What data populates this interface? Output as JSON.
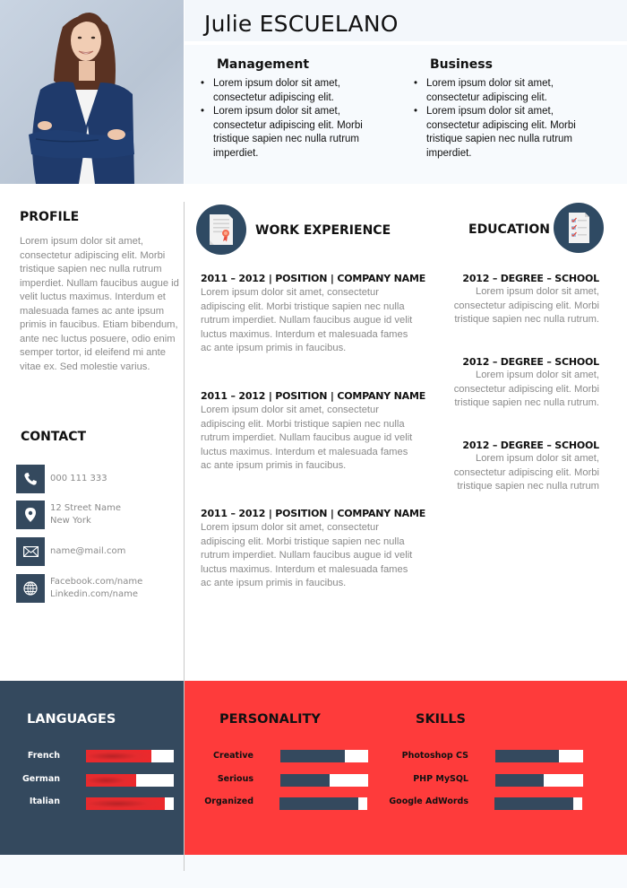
{
  "header": {
    "name": "Julie ESCUELANO",
    "columns": [
      {
        "title": "Management",
        "bullets": [
          "Lorem ipsum dolor sit amet, consectetur adipiscing elit.",
          "Lorem ipsum dolor sit amet, consectetur adipiscing elit. Morbi tristique sapien nec nulla rutrum imperdiet."
        ]
      },
      {
        "title": "Business",
        "bullets": [
          "Lorem ipsum dolor sit amet, consectetur adipiscing elit.",
          "Lorem ipsum dolor sit amet, consectetur adipiscing elit. Morbi tristique sapien nec nulla rutrum imperdiet."
        ]
      }
    ]
  },
  "photo": {
    "alt": "portrait-photo"
  },
  "profile": {
    "title": "PROFILE",
    "text": "Lorem ipsum dolor sit amet, consectetur adipiscing elit. Morbi tristique sapien nec nulla rutrum imperdiet. Nullam faucibus augue id velit luctus maximus. Interdum et malesuada fames ac ante ipsum primis in faucibus. Etiam bibendum, ante nec luctus posuere, odio enim semper tortor, id eleifend mi ante vitae ex. Sed molestie varius."
  },
  "contact": {
    "title": "CONTACT",
    "items": [
      {
        "icon": "phone-icon",
        "lines": [
          "000 111 333"
        ]
      },
      {
        "icon": "location-pin-icon",
        "lines": [
          "12 Street  Name",
          "New York"
        ]
      },
      {
        "icon": "envelope-icon",
        "lines": [
          "name@mail.com"
        ]
      },
      {
        "icon": "globe-icon",
        "lines": [
          "Facebook.com/name",
          "Linkedin.com/name"
        ]
      }
    ]
  },
  "work": {
    "title": "WORK EXPERIENCE",
    "icon": "certificate-icon",
    "jobs": [
      {
        "heading": "2011 – 2012  |  POSITION |  COMPANY NAME",
        "text": "Lorem ipsum dolor sit amet, consectetur adipiscing elit. Morbi tristique sapien nec nulla rutrum imperdiet. Nullam faucibus augue id velit luctus maximus. Interdum et malesuada fames ac ante ipsum primis in faucibus."
      },
      {
        "heading": "2011 – 2012  |  POSITION |  COMPANY NAME",
        "text": "Lorem ipsum dolor sit amet, consectetur adipiscing elit. Morbi tristique sapien nec nulla rutrum imperdiet. Nullam faucibus augue id velit luctus maximus. Interdum et malesuada fames ac ante ipsum primis in faucibus."
      },
      {
        "heading": "2011 – 2012  |  POSITION |  COMPANY NAME",
        "text": "Lorem ipsum dolor sit amet, consectetur adipiscing elit. Morbi tristique sapien nec nulla rutrum imperdiet. Nullam faucibus augue id velit luctus maximus. Interdum et malesuada fames ac ante ipsum primis in faucibus."
      }
    ]
  },
  "education": {
    "title": "EDUCATION",
    "icon": "checklist-document-icon",
    "entries": [
      {
        "heading": "2012  – DEGREE – SCHOOL",
        "text": "Lorem ipsum dolor sit amet, consectetur adipiscing elit. Morbi tristique sapien nec nulla rutrum."
      },
      {
        "heading": "2012  – DEGREE – SCHOOL",
        "text": "Lorem ipsum dolor sit amet, consectetur adipiscing elit. Morbi tristique sapien nec nulla rutrum."
      },
      {
        "heading": "2012  – DEGREE – SCHOOL",
        "text": "Lorem ipsum dolor sit amet, consectetur adipiscing elit. Morbi tristique sapien nec nulla rutrum"
      }
    ]
  },
  "languages": {
    "title": "LANGUAGES",
    "items": [
      {
        "label": "French",
        "level": 0.74
      },
      {
        "label": "German",
        "level": 0.57
      },
      {
        "label": "Italian",
        "level": 0.9
      }
    ]
  },
  "personality": {
    "title": "PERSONALITY",
    "items": [
      {
        "label": "Creative",
        "level": 0.73
      },
      {
        "label": "Serious",
        "level": 0.56
      },
      {
        "label": "Organized",
        "level": 0.9
      }
    ]
  },
  "skills": {
    "title": "SKILLS",
    "items": [
      {
        "label": "Photoshop  CS",
        "level": 0.72
      },
      {
        "label": "PHP MySQL",
        "level": 0.55
      },
      {
        "label": "Google AdWords",
        "level": 0.9
      }
    ]
  },
  "colors": {
    "navy": "#34495e",
    "red": "#fe3b3b",
    "light_bg": "#f7fafd"
  }
}
